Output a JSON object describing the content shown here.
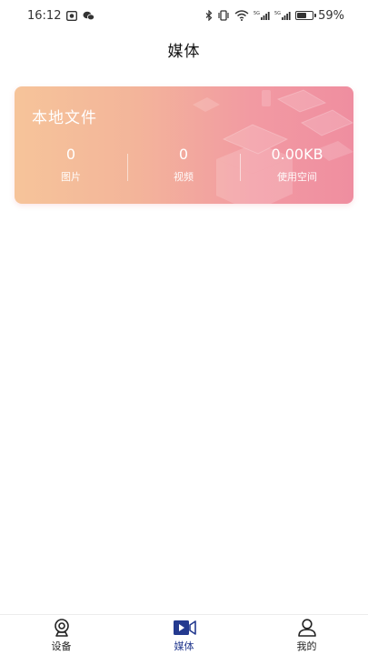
{
  "status_bar": {
    "time": "16:12",
    "battery_text": "59%",
    "battery_level": 0.59,
    "left_icons": [
      "gallery-notification-icon",
      "wechat-icon"
    ],
    "right_icons": [
      "bluetooth-icon",
      "vibrate-icon",
      "wifi-icon",
      "signal-5g-icon",
      "signal-5g-icon-2",
      "battery-icon"
    ]
  },
  "header": {
    "title": "媒体"
  },
  "local_files_card": {
    "title": "本地文件",
    "stats": [
      {
        "value": "0",
        "label": "图片"
      },
      {
        "value": "0",
        "label": "视频"
      },
      {
        "value": "0.00KB",
        "label": "使用空间"
      }
    ],
    "colors": {
      "gradient_start": "#f6c49a",
      "gradient_end": "#ef8ea0"
    }
  },
  "bottom_nav": {
    "active_index": 1,
    "accent_color": "#243a8f",
    "items": [
      {
        "label": "设备",
        "icon": "camera-device-icon"
      },
      {
        "label": "媒体",
        "icon": "video-media-icon"
      },
      {
        "label": "我的",
        "icon": "profile-icon"
      }
    ]
  }
}
